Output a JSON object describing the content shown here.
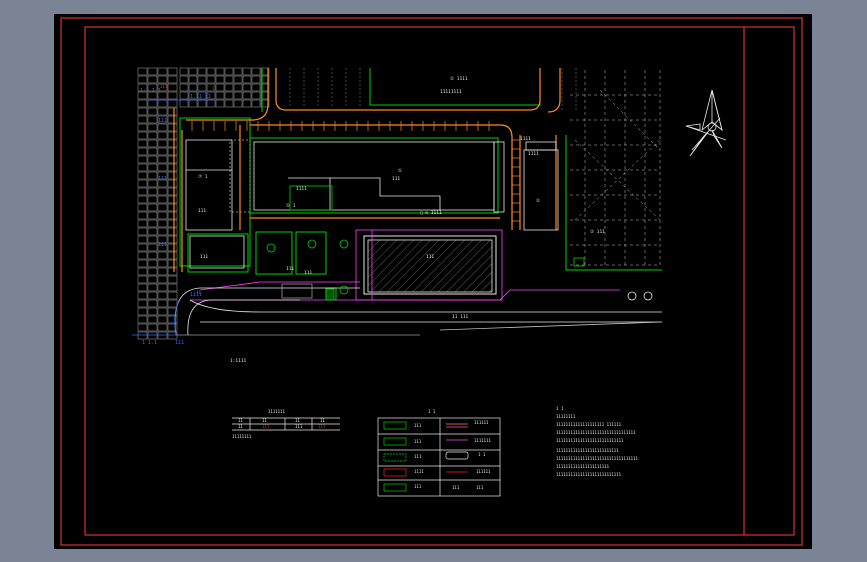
{
  "viewport": {
    "background": "#7b8494",
    "drawing_bg": "#000000"
  },
  "colors": {
    "border": "#ff3b3b",
    "green": "#00d000",
    "white": "#e8e8e8",
    "magenta": "#ff40ff",
    "yellow": "#f0f000",
    "orange": "#ff8a1e",
    "blue": "#2a6cff",
    "red": "#ff2020",
    "gray": "#9a9a9a"
  },
  "drawing": {
    "compass_symbol": "north-arrow-icon",
    "legend_title": "1  1",
    "notes_header": "1 1",
    "scale_caption": "1:XXXXX"
  }
}
